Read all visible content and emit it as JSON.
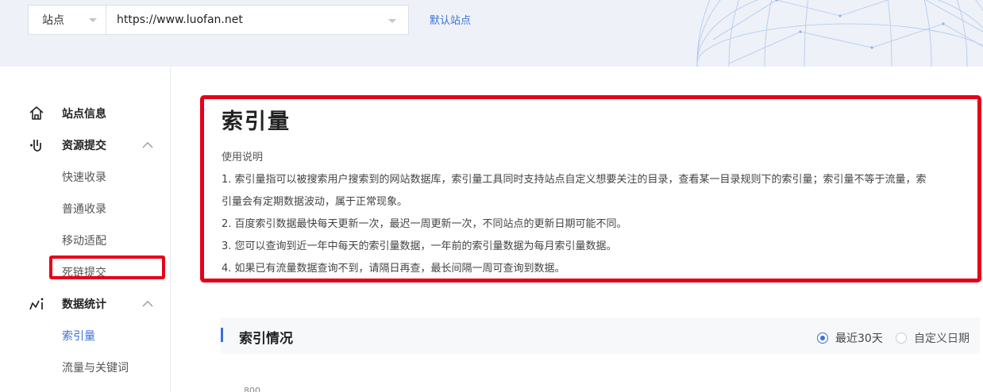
{
  "topbar": {
    "site_label": "站点",
    "url": "https://www.luofan.net",
    "default_site_link": "默认站点"
  },
  "sidebar": {
    "groups": [
      {
        "label": "站点信息",
        "icon": "home-icon"
      },
      {
        "label": "资源提交",
        "icon": "submit-icon",
        "expanded": true,
        "children": [
          "快速收录",
          "普通收录",
          "移动适配",
          "死链提交"
        ]
      },
      {
        "label": "数据统计",
        "icon": "stats-icon",
        "expanded": true,
        "children": [
          "索引量",
          "流量与关键词"
        ]
      }
    ],
    "active_item": "索引量"
  },
  "main": {
    "title": "索引量",
    "usage_title": "使用说明",
    "usage_lines": [
      "1. 索引量指可以被搜索用户搜索到的网站数据库，索引量工具同时支持站点自定义想要关注的目录，查看某一目录规则下的索引量；索引量不等于流量，索",
      "引量会有定期数据波动，属于正常现象。",
      "2. 百度索引数据最快每天更新一次，最迟一周更新一次，不同站点的更新日期可能不同。",
      "3. 您可以查询到近一年中每天的索引量数据，一年前的索引量数据为每月索引量数据。",
      "4. 如果已有流量数据查询不到，请隔日再查，最长间隔一周可查询到数据。"
    ],
    "section_title": "索引情况",
    "range_options": [
      {
        "label": "最近30天",
        "selected": true
      },
      {
        "label": "自定义日期",
        "selected": false
      }
    ],
    "chart_first_tick": "800"
  },
  "colors": {
    "accent": "#3a6fd8",
    "highlight_red": "#e5001a",
    "banner_bg": "#eef1f7"
  }
}
